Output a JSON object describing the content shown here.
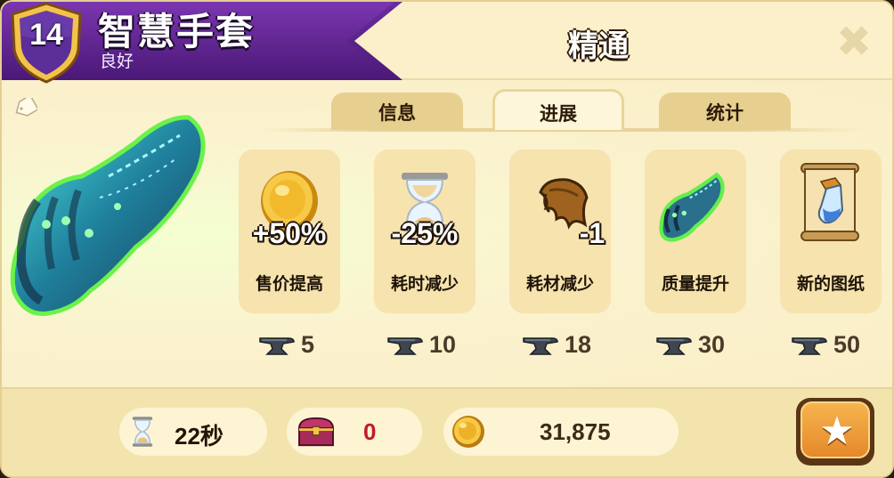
{
  "header": {
    "level": "14",
    "item_name": "智慧手套",
    "quality": "良好",
    "section_title": "精通",
    "close_glyph": "✖"
  },
  "tabs": [
    {
      "label": "信息",
      "active": false
    },
    {
      "label": "进展",
      "active": true
    },
    {
      "label": "统计",
      "active": false
    }
  ],
  "upgrades": [
    {
      "icon": "gold-coin-icon",
      "value": "+50%",
      "label": "售价提高",
      "cost": "5"
    },
    {
      "icon": "hourglass-icon",
      "value": "-25%",
      "label": "耗时减少",
      "cost": "10"
    },
    {
      "icon": "leather-material-icon",
      "value": "-1",
      "label": "耗材减少",
      "cost": "18"
    },
    {
      "icon": "glove-icon",
      "value": "",
      "label": "质量提升",
      "cost": "30"
    },
    {
      "icon": "blueprint-scroll-icon",
      "value": "",
      "label": "新的图纸",
      "cost": "50"
    }
  ],
  "footer": {
    "craft_time": "22秒",
    "chest_count": "0",
    "gold_value": "31,875",
    "favorite_glyph": "★"
  },
  "colors": {
    "title_band": "#5a2388",
    "panel_bg": "#fbf0c9",
    "card_bg": "#f6e3ae",
    "tab_bg": "#e7cf8f",
    "chest_count": "#c21a2a",
    "favorite_button": "#eb9433"
  }
}
